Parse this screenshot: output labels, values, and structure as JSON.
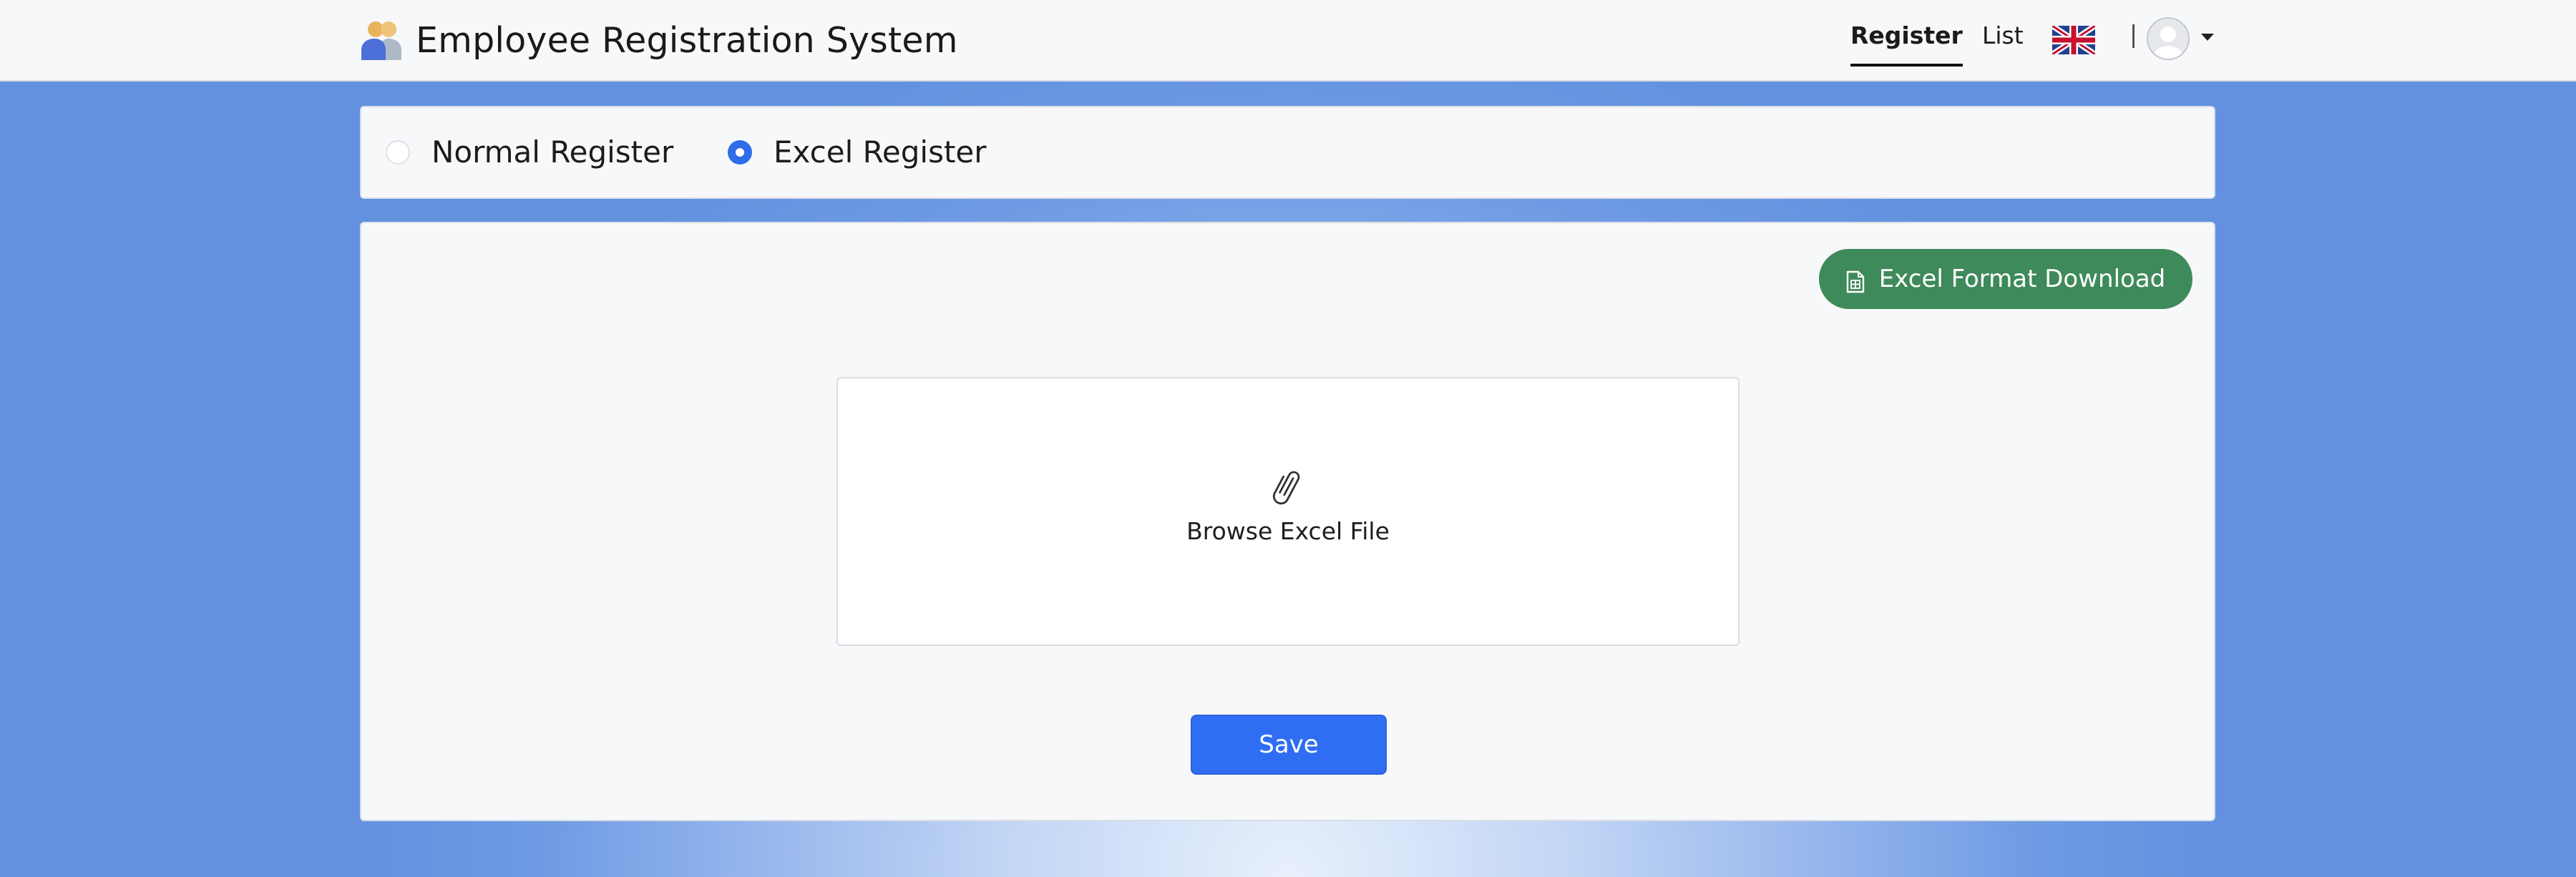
{
  "app": {
    "title": "Employee Registration System",
    "logo_icon": "users-icon"
  },
  "nav": {
    "register_label": "Register",
    "list_label": "List",
    "active": "Register",
    "language_icon": "uk-flag-icon",
    "separator": "|",
    "user_icon": "user-avatar-icon"
  },
  "register_mode": {
    "options": [
      {
        "label": "Normal Register",
        "selected": false
      },
      {
        "label": "Excel Register",
        "selected": true
      }
    ]
  },
  "excel_panel": {
    "download_label": "Excel Format Download",
    "download_icon": "spreadsheet-file-icon",
    "browse_label": "Browse Excel File",
    "browse_icon": "paperclip-icon",
    "save_label": "Save"
  },
  "colors": {
    "primary": "#2f6ef2",
    "download_button": "#3f8a5a",
    "radio_checked": "#2f6de8",
    "background_edge": "#6391e0",
    "background_center": "#e8f0fc"
  }
}
